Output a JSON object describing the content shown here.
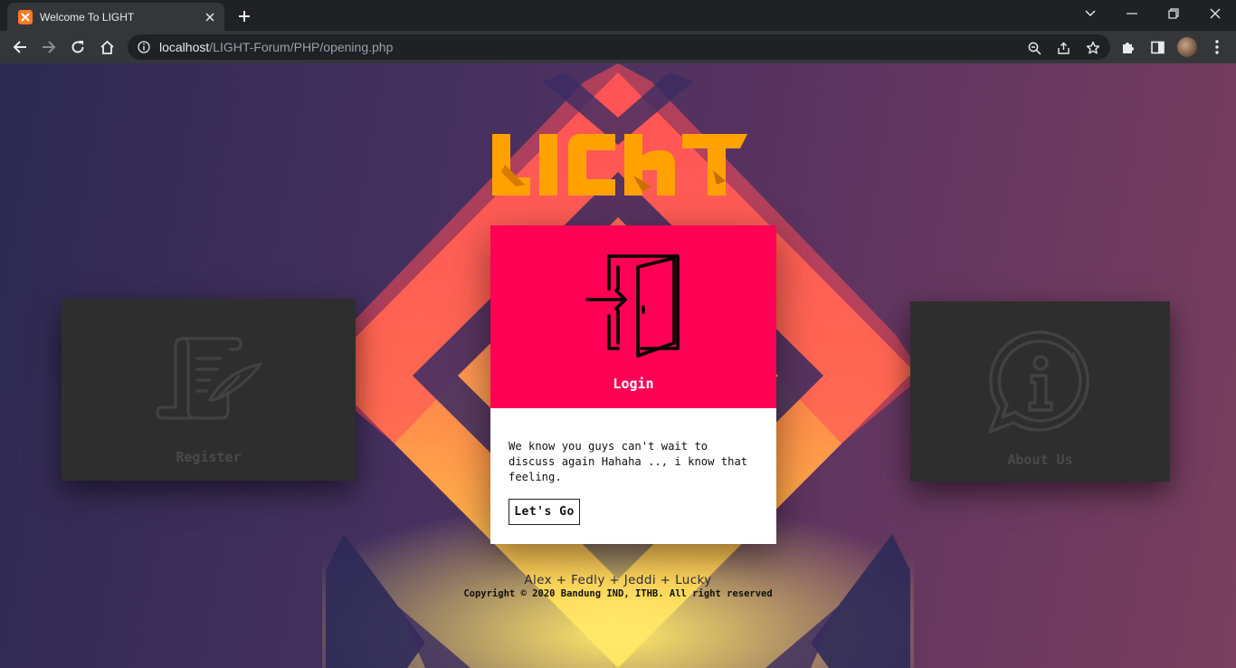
{
  "browser": {
    "tab_title": "Welcome To LIGHT",
    "url_host": "localhost",
    "url_path": "/LIGHT-Forum/PHP/opening.php"
  },
  "page": {
    "logo_text": "LIGHT",
    "login": {
      "label": "Login",
      "description": "We know you guys can't wait to discuss again Hahaha .., i know that feeling.",
      "button_label": "Let's Go"
    },
    "register": {
      "label": "Register"
    },
    "about": {
      "label": "About Us"
    },
    "footer": {
      "authors": "Alex + Fedly + Jeddi + Lucky",
      "copyright": "Copyright © 2020 Bandung IND, ITHB. All right reserved"
    }
  },
  "colors": {
    "login_accent": "#ff0055",
    "logo": "#ffa200",
    "dark_card": "#2e2e2e"
  }
}
